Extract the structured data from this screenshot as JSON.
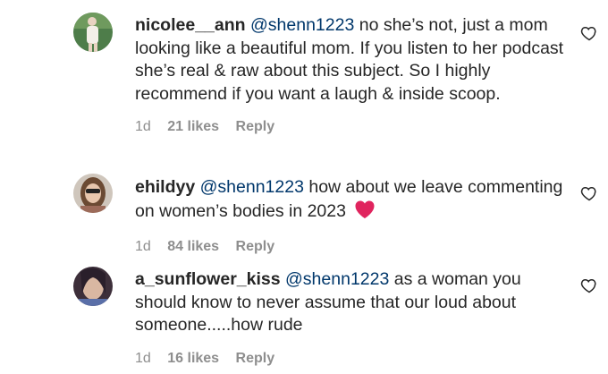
{
  "comments": [
    {
      "username": "nicolee__ann",
      "mention": "@shenn1223",
      "text": "no she’s not, just a mom looking like a beautiful mom. If you listen to her podcast she’s real & raw about this subject. So I highly recommend if you want a laugh & inside scoop.",
      "age": "1d",
      "likes": "21 likes",
      "reply": "Reply"
    },
    {
      "username": "ehildyy",
      "mention": "@shenn1223",
      "text": "how about we leave commenting on women’s bodies in 2023",
      "age": "1d",
      "likes": "84 likes",
      "reply": "Reply"
    },
    {
      "username": "a_sunflower_kiss",
      "mention": "@shenn1223",
      "text": "as a woman you should know to never assume that our loud about someone.....how rude",
      "age": "1d",
      "likes": "16 likes",
      "reply": "Reply"
    }
  ],
  "icons": {
    "like": "heart-outline-icon",
    "emoji": "red-heart-emoji-icon"
  },
  "colors": {
    "mention": "#00376b",
    "meta": "#8e8e8e",
    "heart": "#e0245e"
  }
}
